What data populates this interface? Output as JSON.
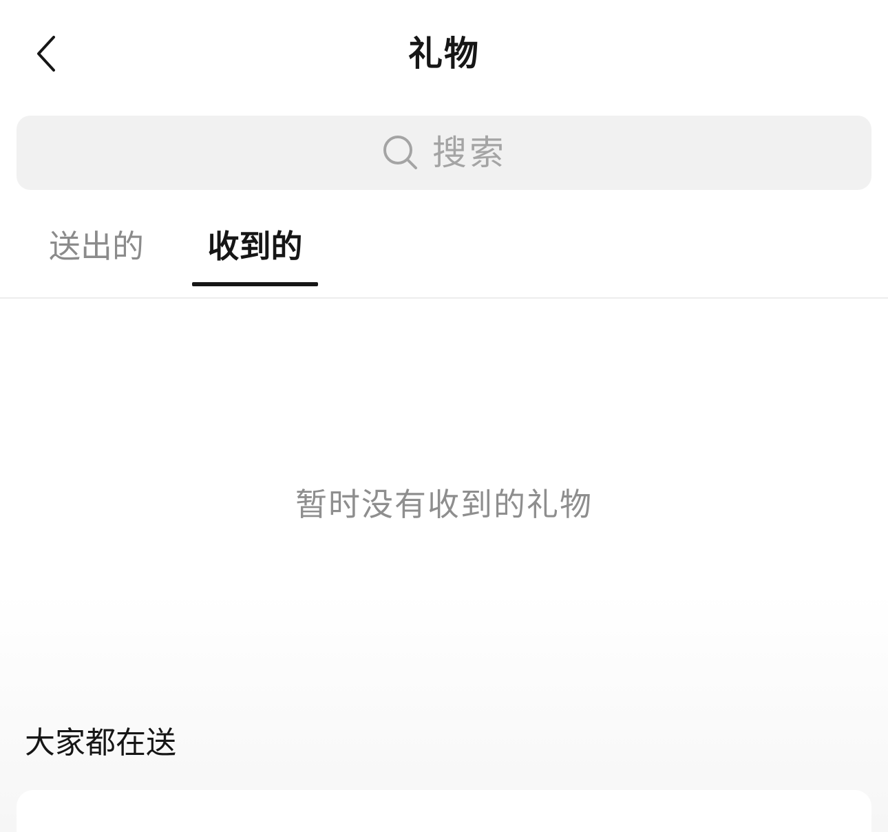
{
  "header": {
    "title": "礼物",
    "back_icon": "chevron-left-icon"
  },
  "search": {
    "placeholder": "搜索",
    "icon": "search-icon"
  },
  "tabs": [
    {
      "label": "送出的",
      "active": false
    },
    {
      "label": "收到的",
      "active": true
    }
  ],
  "empty_state": {
    "message": "暂时没有收到的礼物"
  },
  "recommend_section": {
    "title": "大家都在送"
  },
  "colors": {
    "text_primary": "#161616",
    "text_secondary": "#8b8b8b",
    "search_bg": "#f1f1f1",
    "placeholder": "#a4a4a4",
    "active_indicator": "#161616"
  }
}
